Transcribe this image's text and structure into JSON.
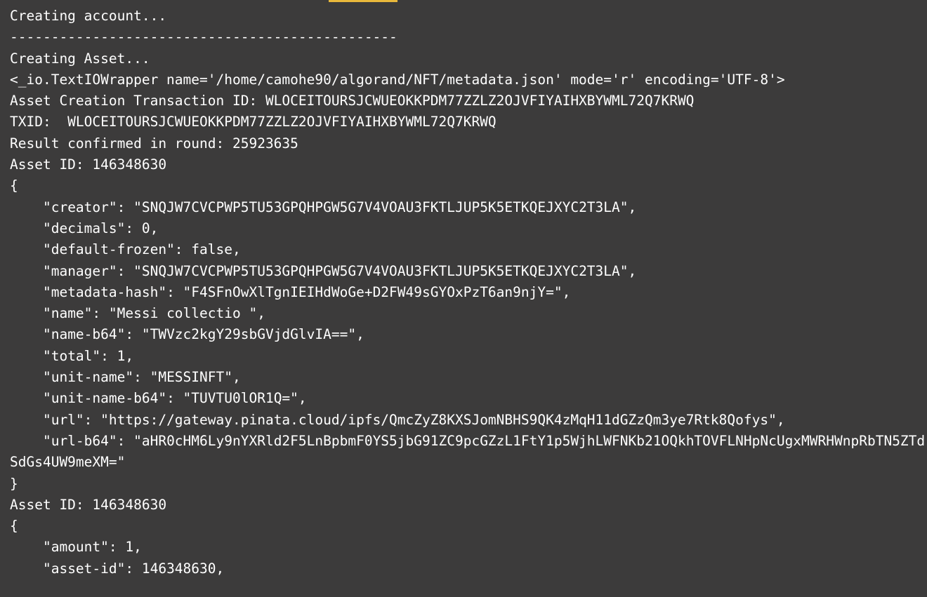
{
  "window": {
    "kind": "terminal-console",
    "background_color": "#3c3b3b",
    "text_color": "#ffffff",
    "accent_color": "#e8b83b"
  },
  "top_bar": {
    "name": "progress-accent-bar",
    "color": "#e8b83b"
  },
  "console": {
    "lines": [
      "Creating account...",
      "-----------------------------------------------",
      "Creating Asset...",
      "<_io.TextIOWrapper name='/home/camohe90/algorand/NFT/metadata.json' mode='r' encoding='UTF-8'>",
      "Asset Creation Transaction ID: WLOCEITOURSJCWUEOKKPDM77ZZLZ2OJVFIYAIHXBYWML72Q7KRWQ",
      "TXID:  WLOCEITOURSJCWUEOKKPDM77ZZLZ2OJVFIYAIHXBYWML72Q7KRWQ",
      "Result confirmed in round: 25923635",
      "Asset ID: 146348630",
      "{",
      "    \"creator\": \"SNQJW7CVCPWP5TU53GPQHPGW5G7V4VOAU3FKTLJUP5K5ETKQEJXYC2T3LA\",",
      "    \"decimals\": 0,",
      "    \"default-frozen\": false,",
      "    \"manager\": \"SNQJW7CVCPWP5TU53GPQHPGW5G7V4VOAU3FKTLJUP5K5ETKQEJXYC2T3LA\",",
      "    \"metadata-hash\": \"F4SFnOwXlTgnIEIHdWoGe+D2FW49sGYOxPzT6an9njY=\",",
      "    \"name\": \"Messi collectio \",",
      "    \"name-b64\": \"TWVzc2kgY29sbGVjdGlvIA==\",",
      "    \"total\": 1,",
      "    \"unit-name\": \"MESSINFT\",",
      "    \"unit-name-b64\": \"TUVTU0lOR1Q=\",",
      "    \"url\": \"https://gateway.pinata.cloud/ipfs/QmcZyZ8KXSJomNBHS9QK4zMqH11dGZzQm3ye7Rtk8Qofys\",",
      "    \"url-b64\": \"aHR0cHM6Ly9nYXRld2F5LnBpbmF0YS5jbG91ZC9pcGZzL1FtY1p5WjhLWFNKb21OQkhTOVFLNHpNcUgxMWRHWnpRbTN5ZTdSdGs4UW9meXM=\"",
      "}",
      "Asset ID: 146348630",
      "{",
      "    \"amount\": 1,",
      "    \"asset-id\": 146348630,"
    ]
  }
}
